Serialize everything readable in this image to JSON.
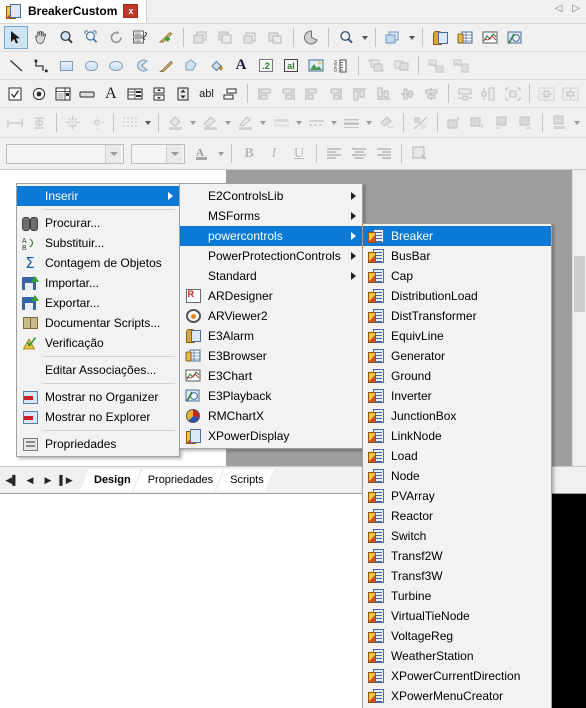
{
  "window": {
    "document_tab_title": "BreakerCustom",
    "tab_icon": "document-component-icon",
    "close_label": "x",
    "nav_left": "◁",
    "nav_right": "▷"
  },
  "toolbars": {
    "row1": [
      {
        "name": "select-tool",
        "icon": "arrow-cursor-icon",
        "selected": true
      },
      {
        "name": "pan-tool",
        "icon": "hand-icon"
      },
      {
        "name": "zoom-tool",
        "icon": "magnifier-icon"
      },
      {
        "name": "zoom-area-tool",
        "icon": "zoom-selection-icon"
      },
      {
        "name": "rotate-tool",
        "icon": "rotate-icon"
      },
      {
        "name": "properties-list",
        "icon": "list-properties-icon"
      },
      {
        "name": "clear-format",
        "icon": "pencil-eraser-icon"
      },
      {
        "name": "separator-1",
        "icon": "separator"
      },
      {
        "name": "bring-to-front",
        "icon": "layer-front-icon"
      },
      {
        "name": "send-to-back",
        "icon": "layer-back-icon"
      },
      {
        "name": "bring-forward",
        "icon": "layer-forward-icon"
      },
      {
        "name": "send-backward",
        "icon": "layer-backward-icon"
      },
      {
        "name": "separator-2",
        "icon": "separator"
      },
      {
        "name": "pie-shape-tool",
        "icon": "pie-icon"
      },
      {
        "name": "separator-3",
        "icon": "separator"
      },
      {
        "name": "find-tool",
        "icon": "search-icon",
        "dropdown": true
      },
      {
        "name": "separator-4",
        "icon": "separator"
      },
      {
        "name": "group-tool",
        "icon": "group-icon",
        "dropdown": true
      },
      {
        "name": "separator-5",
        "icon": "separator"
      },
      {
        "name": "alarm-control",
        "icon": "alarm-icon"
      },
      {
        "name": "browser-control",
        "icon": "grid-icon"
      },
      {
        "name": "chart-control",
        "icon": "chart-icon"
      },
      {
        "name": "playback-control",
        "icon": "playback-icon"
      }
    ],
    "row2": [
      {
        "name": "line-tool",
        "icon": "line-icon"
      },
      {
        "name": "polyline-tool",
        "icon": "polyline-icon"
      },
      {
        "name": "rectangle-tool",
        "icon": "rectangle-icon"
      },
      {
        "name": "rounded-rect-tool",
        "icon": "rounded-rect-icon"
      },
      {
        "name": "ellipse-tool",
        "icon": "ellipse-icon"
      },
      {
        "name": "arc-tool",
        "icon": "arc-icon"
      },
      {
        "name": "pencil-tool",
        "icon": "pencil-icon"
      },
      {
        "name": "polygon-tool",
        "icon": "polygon-icon"
      },
      {
        "name": "fill-tool",
        "icon": "paint-bucket-icon"
      },
      {
        "name": "text-tool",
        "icon": "text-a-icon"
      },
      {
        "name": "display-tool",
        "icon": "display-number-icon"
      },
      {
        "name": "setpoint-tool",
        "icon": "setpoint-icon"
      },
      {
        "name": "image-tool",
        "icon": "image-icon"
      },
      {
        "name": "ruler-tool",
        "icon": "ruler-icon"
      },
      {
        "name": "separator-1",
        "icon": "separator"
      },
      {
        "name": "group-objects",
        "icon": "group-objects-icon"
      },
      {
        "name": "ungroup-objects",
        "icon": "ungroup-objects-icon"
      },
      {
        "name": "separator-2",
        "icon": "separator"
      },
      {
        "name": "link-object",
        "icon": "link-object-icon"
      },
      {
        "name": "unlink-object",
        "icon": "unlink-object-icon"
      }
    ],
    "row3": [
      {
        "name": "checkbox-control",
        "icon": "checkbox-icon"
      },
      {
        "name": "radio-control",
        "icon": "radio-icon"
      },
      {
        "name": "listbox-control",
        "icon": "listbox-icon"
      },
      {
        "name": "button-control",
        "icon": "button-icon"
      },
      {
        "name": "label-control",
        "icon": "label-a-icon"
      },
      {
        "name": "combobox-control",
        "icon": "combobox-icon"
      },
      {
        "name": "spin-control",
        "icon": "spin-icon"
      },
      {
        "name": "scrollbar-control",
        "icon": "scrollbar-icon"
      },
      {
        "name": "textbox-control",
        "icon": "textbox-abl-icon"
      },
      {
        "name": "frame-control",
        "icon": "frame-icon"
      },
      {
        "name": "separator-1",
        "icon": "separator"
      },
      {
        "name": "align-left",
        "icon": "align-left-icon"
      },
      {
        "name": "align-right",
        "icon": "align-right-icon"
      },
      {
        "name": "align-left-2",
        "icon": "align-left-2-icon"
      },
      {
        "name": "align-right-2",
        "icon": "align-right-2-icon"
      },
      {
        "name": "align-top",
        "icon": "align-top-icon"
      },
      {
        "name": "align-bottom",
        "icon": "align-bottom-icon"
      },
      {
        "name": "align-center-v",
        "icon": "align-center-v-icon"
      },
      {
        "name": "align-center-h",
        "icon": "align-center-h-icon"
      },
      {
        "name": "separator-2",
        "icon": "separator"
      },
      {
        "name": "space-horizontal",
        "icon": "space-horizontal-icon"
      },
      {
        "name": "space-vertical",
        "icon": "space-vertical-icon"
      },
      {
        "name": "fit-selection",
        "icon": "fit-selection-icon"
      },
      {
        "name": "separator-3",
        "icon": "separator"
      },
      {
        "name": "center-horizontal",
        "icon": "center-horizontal-icon"
      },
      {
        "name": "center-vertical",
        "icon": "center-vertical-icon"
      }
    ],
    "row4": [
      {
        "name": "same-width",
        "icon": "same-width-icon"
      },
      {
        "name": "same-height",
        "icon": "same-height-icon"
      },
      {
        "name": "separator-1",
        "icon": "separator"
      },
      {
        "name": "nudge-all",
        "icon": "nudge-all-icon"
      },
      {
        "name": "nudge-node",
        "icon": "nudge-node-icon"
      },
      {
        "name": "separator-2",
        "icon": "separator"
      },
      {
        "name": "grid-settings",
        "icon": "grid-dots-icon",
        "dropdown": true
      },
      {
        "name": "separator-3",
        "icon": "separator"
      },
      {
        "name": "fill-color",
        "icon": "fill-color-icon",
        "dropdown": true
      },
      {
        "name": "background-color",
        "icon": "background-color-icon",
        "dropdown": true
      },
      {
        "name": "line-color",
        "icon": "line-color-icon",
        "dropdown": true
      },
      {
        "name": "fill-style",
        "icon": "fill-style-icon",
        "dropdown": true
      },
      {
        "name": "border-style",
        "icon": "border-style-icon",
        "dropdown": true
      },
      {
        "name": "line-weight",
        "icon": "line-weight-icon",
        "dropdown": true
      },
      {
        "name": "gradient-fill",
        "icon": "gradient-fill-icon"
      },
      {
        "name": "separator-4",
        "icon": "separator"
      },
      {
        "name": "transparency",
        "icon": "transparency-icon"
      },
      {
        "name": "separator-5",
        "icon": "separator"
      },
      {
        "name": "shadow-up",
        "icon": "shadow-up-icon"
      },
      {
        "name": "shadow-down",
        "icon": "shadow-down-icon"
      },
      {
        "name": "shadow-left",
        "icon": "shadow-left-icon"
      },
      {
        "name": "shadow-right",
        "icon": "shadow-right-icon"
      },
      {
        "name": "separator-6",
        "icon": "separator"
      },
      {
        "name": "shadow-style",
        "icon": "shadow-style-icon",
        "dropdown": true
      }
    ],
    "format_bar": {
      "font_name_value": "",
      "font_name_placeholder": "",
      "font_size_value": "",
      "font_size_placeholder": "",
      "font_color": "font-color-icon",
      "bold_label": "B",
      "italic_label": "I",
      "underline_label": "U",
      "align_left": "align-text-left-icon",
      "align_center": "align-text-center-icon",
      "align_right": "align-text-right-icon",
      "object_props": "object-properties-icon"
    }
  },
  "context_menu": {
    "items": [
      {
        "label": "Inserir",
        "icon": "",
        "submenu": true,
        "selected": true
      },
      {
        "separator_after": false,
        "label": "Procurar...",
        "icon": "binoculars-icon"
      },
      {
        "label": "Substituir...",
        "icon": "replace-icon"
      },
      {
        "label": "Contagem de Objetos",
        "icon": "sigma-icon"
      },
      {
        "label": "Importar...",
        "icon": "import-disk-icon"
      },
      {
        "label": "Exportar...",
        "icon": "export-disk-icon"
      },
      {
        "label": "Documentar Scripts...",
        "icon": "book-icon"
      },
      {
        "label": "Verificação",
        "icon": "warning-check-icon"
      },
      {
        "label": "Editar Associações...",
        "icon": ""
      },
      {
        "label": "Mostrar no Organizer",
        "icon": "organizer-icon"
      },
      {
        "label": "Mostrar no Explorer",
        "icon": "explorer-icon"
      },
      {
        "label": "Propriedades",
        "icon": "properties-icon"
      }
    ]
  },
  "insert_submenu": {
    "items": [
      {
        "label": "E2ControlsLib",
        "icon": "",
        "submenu": true
      },
      {
        "label": "MSForms",
        "icon": "",
        "submenu": true
      },
      {
        "label": "powercontrols",
        "icon": "",
        "submenu": true,
        "selected": true
      },
      {
        "label": "PowerProtectionControls",
        "icon": "",
        "submenu": true
      },
      {
        "label": "Standard",
        "icon": "",
        "submenu": true
      },
      {
        "label": "ARDesigner",
        "icon": "ardesigner-icon"
      },
      {
        "label": "ARViewer2",
        "icon": "arviewer-icon"
      },
      {
        "label": "E3Alarm",
        "icon": "alarm-icon"
      },
      {
        "label": "E3Browser",
        "icon": "browser-grid-icon"
      },
      {
        "label": "E3Chart",
        "icon": "chart-icon"
      },
      {
        "label": "E3Playback",
        "icon": "playback-icon"
      },
      {
        "label": "RMChartX",
        "icon": "pie-chart-icon"
      },
      {
        "label": "XPowerDisplay",
        "icon": "xpower-display-icon"
      }
    ]
  },
  "powercontrols_submenu": {
    "icon": "component-icon",
    "items": [
      {
        "label": "Breaker",
        "selected": true
      },
      {
        "label": "BusBar"
      },
      {
        "label": "Cap"
      },
      {
        "label": "DistributionLoad"
      },
      {
        "label": "DistTransformer"
      },
      {
        "label": "EquivLine"
      },
      {
        "label": "Generator"
      },
      {
        "label": "Ground"
      },
      {
        "label": "Inverter"
      },
      {
        "label": "JunctionBox"
      },
      {
        "label": "LinkNode"
      },
      {
        "label": "Load"
      },
      {
        "label": "Node"
      },
      {
        "label": "PVArray"
      },
      {
        "label": "Reactor"
      },
      {
        "label": "Switch"
      },
      {
        "label": "Transf2W"
      },
      {
        "label": "Transf3W"
      },
      {
        "label": "Turbine"
      },
      {
        "label": "VirtualTieNode"
      },
      {
        "label": "VoltageReg"
      },
      {
        "label": "WeatherStation"
      },
      {
        "label": "XPowerCurrentDirection"
      },
      {
        "label": "XPowerMenuCreator"
      }
    ]
  },
  "sheet_tabs": {
    "nav": [
      "◀▌",
      "◀",
      "▶",
      "▌▶"
    ],
    "tabs": [
      {
        "label": "Design",
        "active": true
      },
      {
        "label": "Propriedades",
        "active": false
      },
      {
        "label": "Scripts",
        "active": false
      }
    ]
  },
  "colors": {
    "menu_highlight": "#0a7ad6",
    "menu_background": "#f2f2f2",
    "toolbar_background": "#f0f0f0",
    "canvas_background": "#9e9e9e",
    "page_background": "#ffffff",
    "close_button": "#c0392b"
  }
}
